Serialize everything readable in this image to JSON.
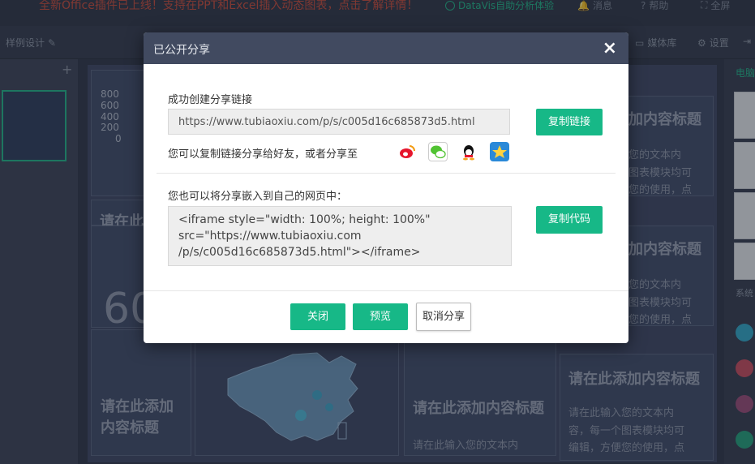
{
  "topbar": {
    "notice": "全新Office插件已上线！支持在PPT和Excel插入动态图表，点击了解详情！",
    "datavis": "DataVis自助分析体验",
    "messages": "消息",
    "help": "帮助",
    "fullscreen": "全屏"
  },
  "toolbar": {
    "sample_design": "样例设计",
    "media_library": "媒体库",
    "settings": "设置",
    "right_label": "电脑"
  },
  "canvas": {
    "chart_axis": [
      "800",
      "600",
      "400",
      "200",
      "0"
    ],
    "card_titles": {
      "title_right_1": "加内容标题",
      "title_right_2": "加内容标题",
      "title_left_big": "请在此添加\n内容标题",
      "title_mid": "请在此添加内容标题",
      "title_right_3": "请在此添加内容标题",
      "partial_left": "请在此",
      "big_number": "60"
    },
    "card_texts": {
      "text_right_1": [
        "您的文本内",
        "图表模块均可",
        "您的使用，点"
      ],
      "text_right_2": [
        "您的文本内",
        "图表模块均可",
        "您的使用，点"
      ],
      "text_mid": "请在此输入您的文本内",
      "text_right_3": [
        "请在此输入您的文本内",
        "容，每一个图表模块均可",
        "编辑，方便您的使用，点"
      ]
    },
    "right_panel_label": "系统"
  },
  "modal": {
    "title": "已公开分享",
    "close_icon": "close-icon",
    "link_section_label": "成功创建分享链接",
    "share_link": "https://www.tubiaoxiu.com/p/s/c005d16c685873d5.html",
    "copy_link_button": "复制链接",
    "share_to_text": "您可以复制链接分享给好友，或者分享至",
    "share_icons": [
      "weibo-icon",
      "wechat-icon",
      "qq-icon",
      "qzone-icon"
    ],
    "embed_section_label": "您也可以将分享嵌入到自己的网页中：",
    "embed_code": "<iframe style=\"width: 100%; height: 100%\"\nsrc=\"https://www.tubiaoxiu.com\n/p/s/c005d16c685873d5.html\"></iframe>",
    "copy_code_button": "复制代码",
    "close_button": "关闭",
    "preview_button": "预览",
    "cancel_share_button": "取消分享"
  },
  "colors": {
    "accent_green": "#17b887",
    "modal_header": "#414a60",
    "background": "#2d3547"
  }
}
